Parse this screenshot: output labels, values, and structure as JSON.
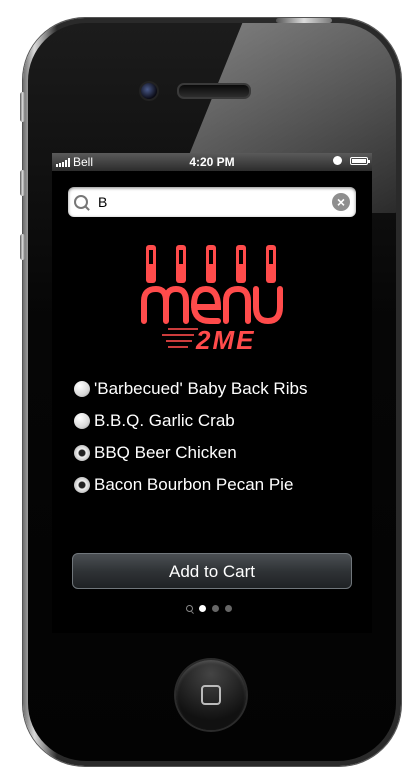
{
  "status": {
    "carrier": "Bell",
    "time": "4:20 PM"
  },
  "search": {
    "value": "B",
    "clear_label": "×"
  },
  "logo": {
    "text": "2ME",
    "accent_color": "#ff4b4b"
  },
  "results": [
    {
      "label": "'Barbecued' Baby Back Ribs",
      "selected": false
    },
    {
      "label": "B.B.Q. Garlic Crab",
      "selected": false
    },
    {
      "label": "BBQ Beer Chicken",
      "selected": true
    },
    {
      "label": "Bacon Bourbon Pecan Pie",
      "selected": true
    }
  ],
  "add_button_label": "Add to Cart",
  "pager": {
    "pages": 3,
    "current": 1
  }
}
